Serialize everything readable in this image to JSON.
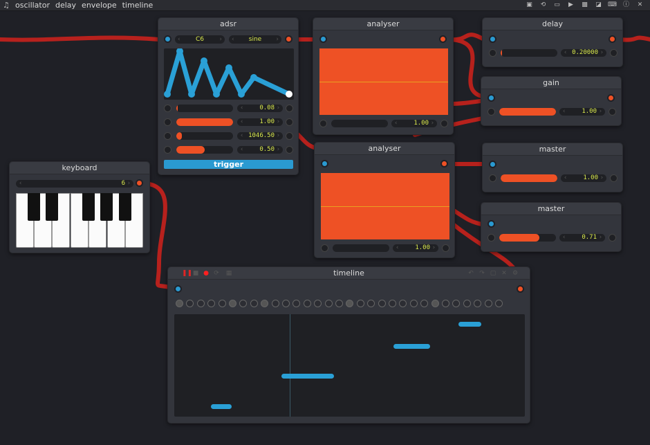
{
  "menu": {
    "logo_icon": "music-note-icon",
    "items": [
      {
        "label": "oscillator"
      },
      {
        "label": "delay"
      },
      {
        "label": "envelope"
      },
      {
        "label": "timeline"
      }
    ],
    "tools": [
      "save-icon",
      "refresh-icon",
      "folder-icon",
      "terminal-icon",
      "image-icon",
      "contrast-icon",
      "keyboard-icon",
      "info-icon",
      "close-icon"
    ]
  },
  "colors": {
    "input_port": "#2a9ad1",
    "output_port": "#ee5125",
    "wire": "#c0221c",
    "value_text": "#d9e84c",
    "note": "#2aa0d6"
  },
  "adsr": {
    "title": "adsr",
    "note_select": "C6",
    "wave_select": "sine",
    "rows": [
      {
        "value": "0.08",
        "fill": 0.02
      },
      {
        "value": "1.00",
        "fill": 1.0
      },
      {
        "value": "1046.50",
        "fill": 0.1
      },
      {
        "value": "0.50",
        "fill": 0.5
      }
    ],
    "trigger_label": "trigger"
  },
  "analyser1": {
    "title": "analyser",
    "value": "1.00"
  },
  "analyser2": {
    "title": "analyser",
    "value": "1.00"
  },
  "delay": {
    "title": "delay",
    "value": "0.20000",
    "fill": 0.02
  },
  "gain": {
    "title": "gain",
    "value": "1.00",
    "fill": 1.0
  },
  "master1": {
    "title": "master",
    "value": "1.00",
    "fill": 1.0
  },
  "master2": {
    "title": "master",
    "value": "0.71",
    "fill": 0.71
  },
  "keyboard": {
    "title": "keyboard",
    "octave": "6"
  },
  "timeline": {
    "title": "timeline",
    "steps": [
      1,
      0,
      0,
      0,
      0,
      1,
      0,
      0,
      1,
      0,
      0,
      0,
      0,
      0,
      0,
      0,
      1,
      0,
      0,
      0,
      0,
      0,
      0,
      0,
      1,
      0,
      0,
      0,
      0,
      0,
      0
    ],
    "notes": [
      {
        "start": 0.105,
        "length": 0.06,
        "pitch": 0.05
      },
      {
        "start": 0.305,
        "length": 0.15,
        "pitch": 0.38
      },
      {
        "start": 0.625,
        "length": 0.105,
        "pitch": 0.7
      },
      {
        "start": 0.81,
        "length": 0.065,
        "pitch": 0.94
      }
    ],
    "playhead": 0.33
  }
}
